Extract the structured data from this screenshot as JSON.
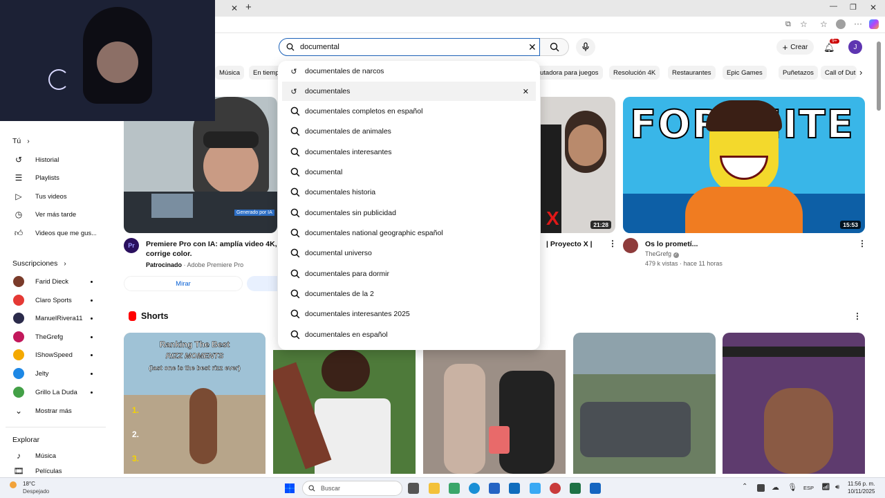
{
  "search": {
    "value": "documental",
    "placeholder": "Buscar"
  },
  "header": {
    "create_label": "Crear",
    "notif_badge": "9+",
    "avatar_letter": "J"
  },
  "chips": [
    "Música",
    "En tiempo",
    "utadora para juegos",
    "Resolución 4K",
    "Restaurantes",
    "Epic Games",
    "Puñetazos",
    "Call of Dut"
  ],
  "suggestions": [
    {
      "text": "documentales de narcos",
      "icon": "history-icon"
    },
    {
      "text": "documentales",
      "icon": "history-icon"
    },
    {
      "text": "documentales completos en español",
      "icon": "search-icon"
    },
    {
      "text": "documentales de animales",
      "icon": "search-icon"
    },
    {
      "text": "documentales interesantes",
      "icon": "search-icon"
    },
    {
      "text": "documental",
      "icon": "search-icon"
    },
    {
      "text": "documentales historia",
      "icon": "search-icon"
    },
    {
      "text": "documentales sin publicidad",
      "icon": "search-icon"
    },
    {
      "text": "documentales national geographic español",
      "icon": "search-icon"
    },
    {
      "text": "documental universo",
      "icon": "search-icon"
    },
    {
      "text": "documentales para dormir",
      "icon": "search-icon"
    },
    {
      "text": "documentales de la 2",
      "icon": "search-icon"
    },
    {
      "text": "documentales interesantes 2025",
      "icon": "search-icon"
    },
    {
      "text": "documentales en español",
      "icon": "search-icon"
    }
  ],
  "sidebar": {
    "you_label": "Tú",
    "you_items": [
      {
        "label": "Historial",
        "icon": "history-icon"
      },
      {
        "label": "Playlists",
        "icon": "playlist-icon"
      },
      {
        "label": "Tus videos",
        "icon": "video-icon"
      },
      {
        "label": "Ver más tarde",
        "icon": "clock-icon"
      },
      {
        "label": "Videos que me gus...",
        "icon": "thumbs-up-icon"
      }
    ],
    "subs_label": "Suscripciones",
    "subs": [
      {
        "label": "Farid Dieck",
        "color": "#7a3b2a"
      },
      {
        "label": "Claro Sports",
        "color": "#e53935"
      },
      {
        "label": "ManuelRivera11",
        "color": "#2b2b4b"
      },
      {
        "label": "TheGrefg",
        "color": "#c2185b"
      },
      {
        "label": "IShowSpeed",
        "color": "#f4a900"
      },
      {
        "label": "Jelty",
        "color": "#1e88e5"
      },
      {
        "label": "Grillo La Duda",
        "color": "#43a047"
      }
    ],
    "more_label": "Mostrar más",
    "explore_label": "Explorar",
    "explore_items": [
      {
        "label": "Música",
        "icon": "music-icon"
      },
      {
        "label": "Películas",
        "icon": "film-icon"
      }
    ]
  },
  "videos": {
    "ad": {
      "title_line1": "Premiere Pro con IA: amplía video 4K, tra",
      "title_line2": "corrige color.",
      "sponsor": "Patrocinado",
      "channel": "Adobe Premiere Pro",
      "cta": "Mirar",
      "badge": "Pr",
      "overlay": "Generado por IA"
    },
    "mid": {
      "title": "| Proyecto X |",
      "duration": "21:28"
    },
    "right": {
      "title": "Os lo prometí...",
      "channel": "TheGrefg",
      "meta": "479 k vistas · hace 11 horas",
      "duration": "15:53",
      "thumb_text": "FORTNITE"
    }
  },
  "shorts": {
    "label": "Shorts",
    "items": [
      {
        "caption_1": "Ranking The Best",
        "caption_2": "RIZZ MOMENTS",
        "caption_3": "(last one is the best rizz ever)",
        "color": "#b7a58a"
      },
      {
        "caption_1": "",
        "color": "#4e7a3a"
      },
      {
        "caption_1": "",
        "color": "#9c8f86"
      },
      {
        "caption_1": "",
        "color": "#6a7b86"
      },
      {
        "caption_1": "",
        "color": "#5e3b6e"
      }
    ]
  },
  "taskbar": {
    "weather_temp": "18°C",
    "weather_desc": "Despejado",
    "search_label": "Buscar",
    "lang": "ESP",
    "time": "11:56 p. m.",
    "date": "10/11/2025"
  },
  "colors": {
    "accent": "#065fd4",
    "yt_red": "#ff0000",
    "dropdown_hl": "#f2f2f2"
  }
}
